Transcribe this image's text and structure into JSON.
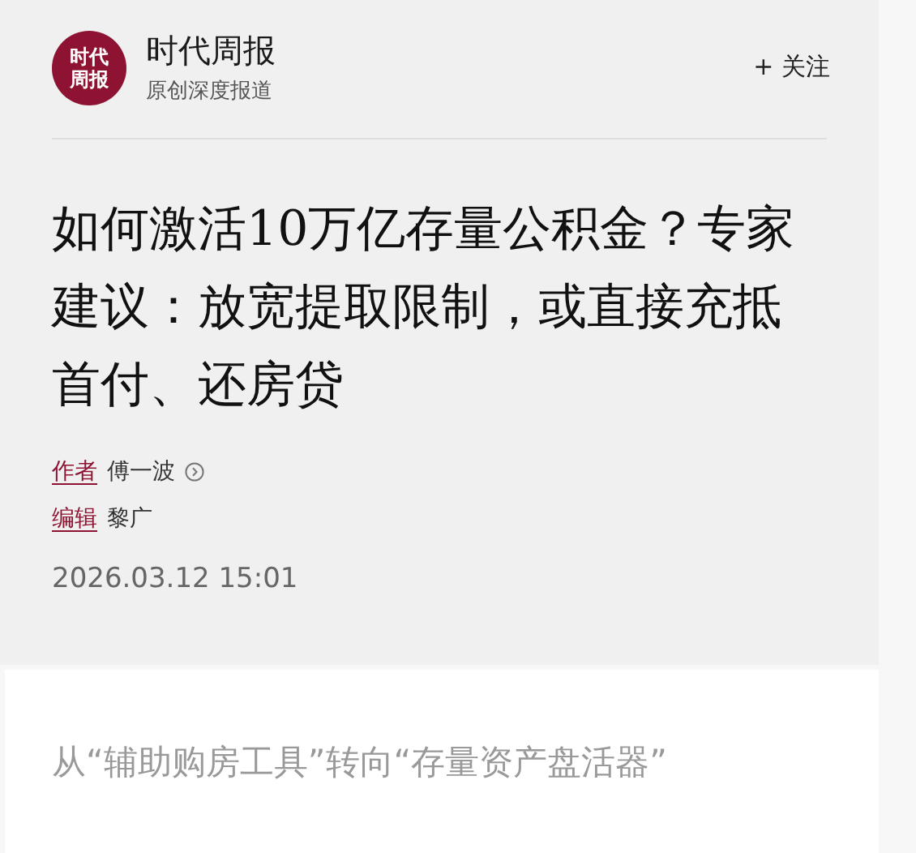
{
  "header": {
    "logo_text": "时代周报",
    "name": "时代周报",
    "tagline": "原创深度报道",
    "follow_button": "+ 关注"
  },
  "article": {
    "title": "如何激活10万亿存量公积金？专家建议：放宽提取限制，或直接充抵首付、还房贷",
    "credits": [
      {
        "role": "作者",
        "name": "傅一波",
        "has_link": true
      },
      {
        "role": "编辑",
        "name": "黎广",
        "has_link": false
      }
    ],
    "date": "2026.03.12 15:01"
  },
  "section_heading": "从“辅助购房工具”转向“存量资产盘活器”"
}
